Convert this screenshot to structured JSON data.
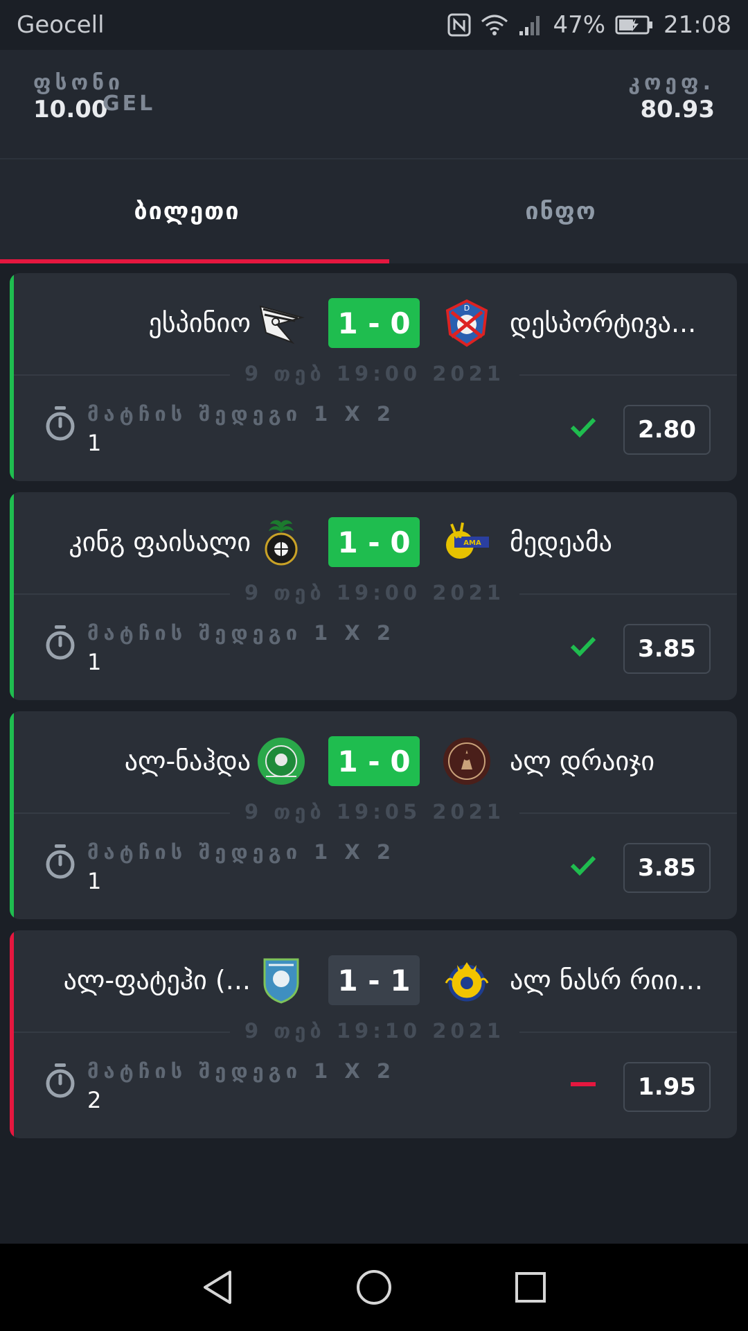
{
  "status_bar": {
    "carrier": "Geocell",
    "battery": "47%",
    "time": "21:08"
  },
  "header": {
    "stake_label": "ფსონი",
    "stake_value": "10.00",
    "stake_currency": "GEL",
    "odds_label": "კოეფ.",
    "odds_value": "80.93"
  },
  "tabs": [
    {
      "label": "ბილეთი",
      "active": true
    },
    {
      "label": "ინფო",
      "active": false
    }
  ],
  "bets": [
    {
      "status": "won",
      "home_team": "ესპინიო",
      "away_team": "დესპორტივა...",
      "score": "1 - 0",
      "date": "9 თებ 19:00 2021",
      "market": "მატჩის შედეგი 1 X 2",
      "selection": "1",
      "odds": "2.80"
    },
    {
      "status": "won",
      "home_team": "კინგ ფაისალი",
      "away_team": "მედეამა",
      "score": "1 - 0",
      "date": "9 თებ 19:00 2021",
      "market": "მატჩის შედეგი 1 X 2",
      "selection": "1",
      "odds": "3.85"
    },
    {
      "status": "won",
      "home_team": "ალ-ნაჰდა",
      "away_team": "ალ დრაიჯი",
      "score": "1 - 0",
      "date": "9 თებ 19:05 2021",
      "market": "მატჩის შედეგი 1 X 2",
      "selection": "1",
      "odds": "3.85"
    },
    {
      "status": "lost",
      "home_team": "ალ-ფატეჰი (...",
      "away_team": "ალ ნასრ რიი...",
      "score": "1 - 1",
      "date": "9 თებ 19:10 2021",
      "market": "მატჩის შედეგი 1 X 2",
      "selection": "2",
      "odds": "1.95"
    }
  ],
  "colors": {
    "won": "#1fbd4f",
    "lost": "#e5173f",
    "background": "#1b1f26",
    "card": "#2a2f37"
  }
}
